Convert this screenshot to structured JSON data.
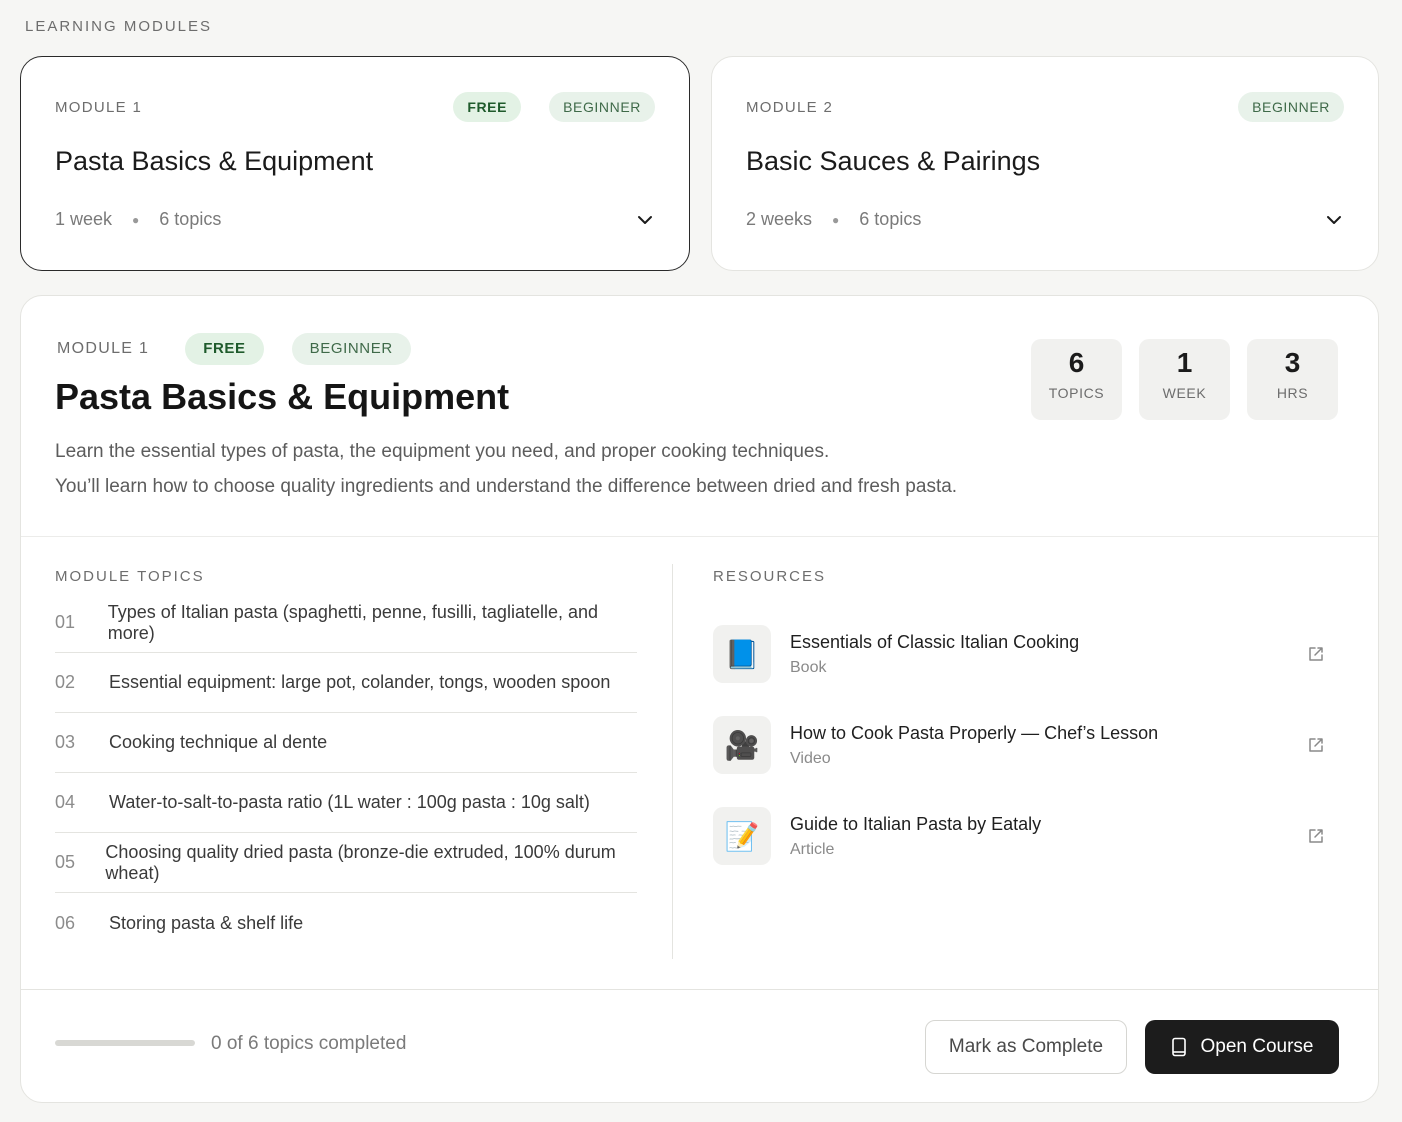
{
  "header": {
    "title": "LEARNING MODULES"
  },
  "modules": [
    {
      "label": "MODULE 1",
      "badges": [
        "FREE",
        "BEGINNER"
      ],
      "title": "Pasta Basics & Equipment",
      "duration": "1 week",
      "topics": "6 topics",
      "selected": true
    },
    {
      "label": "MODULE 2",
      "badges": [
        "BEGINNER"
      ],
      "title": "Basic Sauces & Pairings",
      "duration": "2 weeks",
      "topics": "6 topics",
      "selected": false
    }
  ],
  "detail": {
    "label": "MODULE 1",
    "badge_free": "FREE",
    "badge_level": "BEGINNER",
    "title": "Pasta Basics & Equipment",
    "description_1": "Learn the essential types of pasta, the equipment you need, and proper cooking techniques.",
    "description_2": "You’ll learn how to choose quality ingredients and understand the difference between dried and fresh pasta.",
    "stats": [
      {
        "value": "6",
        "label": "TOPICS"
      },
      {
        "value": "1",
        "label": "WEEK"
      },
      {
        "value": "3",
        "label": "HRS"
      }
    ],
    "topics_title": "MODULE TOPICS",
    "topics": [
      {
        "num": "01",
        "text": "Types of Italian pasta (spaghetti, penne, fusilli, tagliatelle, and more)"
      },
      {
        "num": "02",
        "text": "Essential equipment: large pot, colander, tongs, wooden spoon"
      },
      {
        "num": "03",
        "text": "Cooking technique al dente"
      },
      {
        "num": "04",
        "text": "Water-to-salt-to-pasta ratio (1L water : 100g pasta : 10g salt)"
      },
      {
        "num": "05",
        "text": "Choosing quality dried pasta (bronze-die extruded, 100% durum wheat)"
      },
      {
        "num": "06",
        "text": "Storing pasta & shelf life"
      }
    ],
    "resources_title": "RESOURCES",
    "resources": [
      {
        "icon": "📘",
        "icon_name": "book-icon",
        "name": "Essentials of Classic Italian Cooking",
        "type": "Book"
      },
      {
        "icon": "🎥",
        "icon_name": "video-camera-icon",
        "name": "How to Cook Pasta Properly — Chef’s Lesson",
        "type": "Video"
      },
      {
        "icon": "📝",
        "icon_name": "memo-icon",
        "name": "Guide to Italian Pasta by Eataly",
        "type": "Article"
      }
    ],
    "progress_fraction": 0,
    "progress_text": "0  of 6 topics completed",
    "mark_complete": "Mark as Complete",
    "open_course": "Open Course"
  },
  "colors": {
    "accent": "#1c1c1c",
    "badge_green_bg": "#e3f2e5",
    "badge_green_text": "#1f5b2c"
  }
}
